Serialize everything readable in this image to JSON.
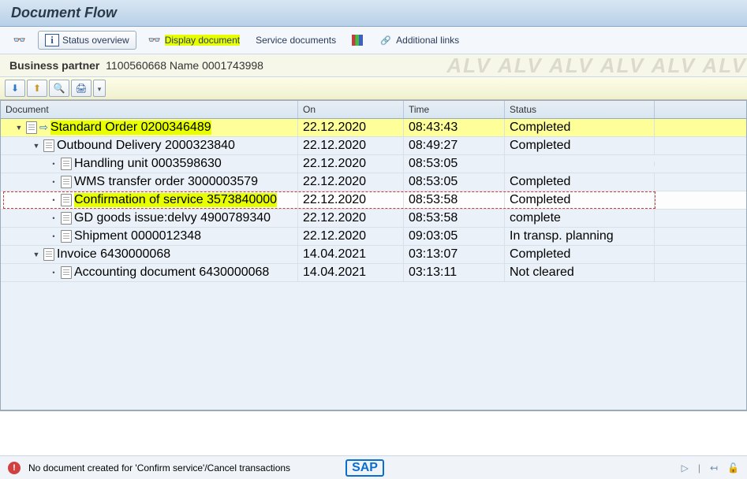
{
  "title": "Document Flow",
  "toolbar": {
    "status_overview": "Status overview",
    "display_document": "Display document",
    "service_documents": "Service documents",
    "additional_links": "Additional links"
  },
  "business_partner": {
    "label": "Business partner",
    "value": "1100560668 Name 0001743998"
  },
  "columns": {
    "doc": "Document",
    "on": "On",
    "time": "Time",
    "status": "Status"
  },
  "rows": [
    {
      "indent": 0,
      "toggle": "▼",
      "arrow": true,
      "label": "Standard Order 0200346489",
      "on": "22.12.2020",
      "time": "08:43:43",
      "status": "Completed",
      "hl": true
    },
    {
      "indent": 1,
      "toggle": "▼",
      "arrow": false,
      "label": "Outbound Delivery 2000323840",
      "on": "22.12.2020",
      "time": "08:49:27",
      "status": "Completed",
      "hl": false
    },
    {
      "indent": 2,
      "toggle": "•",
      "arrow": false,
      "label": "Handling unit 0003598630",
      "on": "22.12.2020",
      "time": "08:53:05",
      "status": "",
      "hl": false
    },
    {
      "indent": 2,
      "toggle": "•",
      "arrow": false,
      "label": "WMS transfer order 3000003579",
      "on": "22.12.2020",
      "time": "08:53:05",
      "status": "Completed",
      "hl": false
    },
    {
      "indent": 2,
      "toggle": "•",
      "arrow": false,
      "label": "Confirmation of service 3573840000",
      "on": "22.12.2020",
      "time": "08:53:58",
      "status": "Completed",
      "hl": true,
      "selected": true
    },
    {
      "indent": 2,
      "toggle": "•",
      "arrow": false,
      "label": "GD goods issue:delvy 4900789340",
      "on": "22.12.2020",
      "time": "08:53:58",
      "status": "complete",
      "hl": false
    },
    {
      "indent": 2,
      "toggle": "•",
      "arrow": false,
      "label": "Shipment 0000012348",
      "on": "22.12.2020",
      "time": "09:03:05",
      "status": "In transp. planning",
      "hl": false
    },
    {
      "indent": 1,
      "toggle": "▼",
      "arrow": false,
      "label": "Invoice 6430000068",
      "on": "14.04.2021",
      "time": "03:13:07",
      "status": "Completed",
      "hl": false
    },
    {
      "indent": 2,
      "toggle": "•",
      "arrow": false,
      "label": "Accounting document 6430000068",
      "on": "14.04.2021",
      "time": "03:13:11",
      "status": "Not cleared",
      "hl": false
    }
  ],
  "status_message": "No document created for 'Confirm service'/Cancel transactions",
  "sap": "SAP"
}
